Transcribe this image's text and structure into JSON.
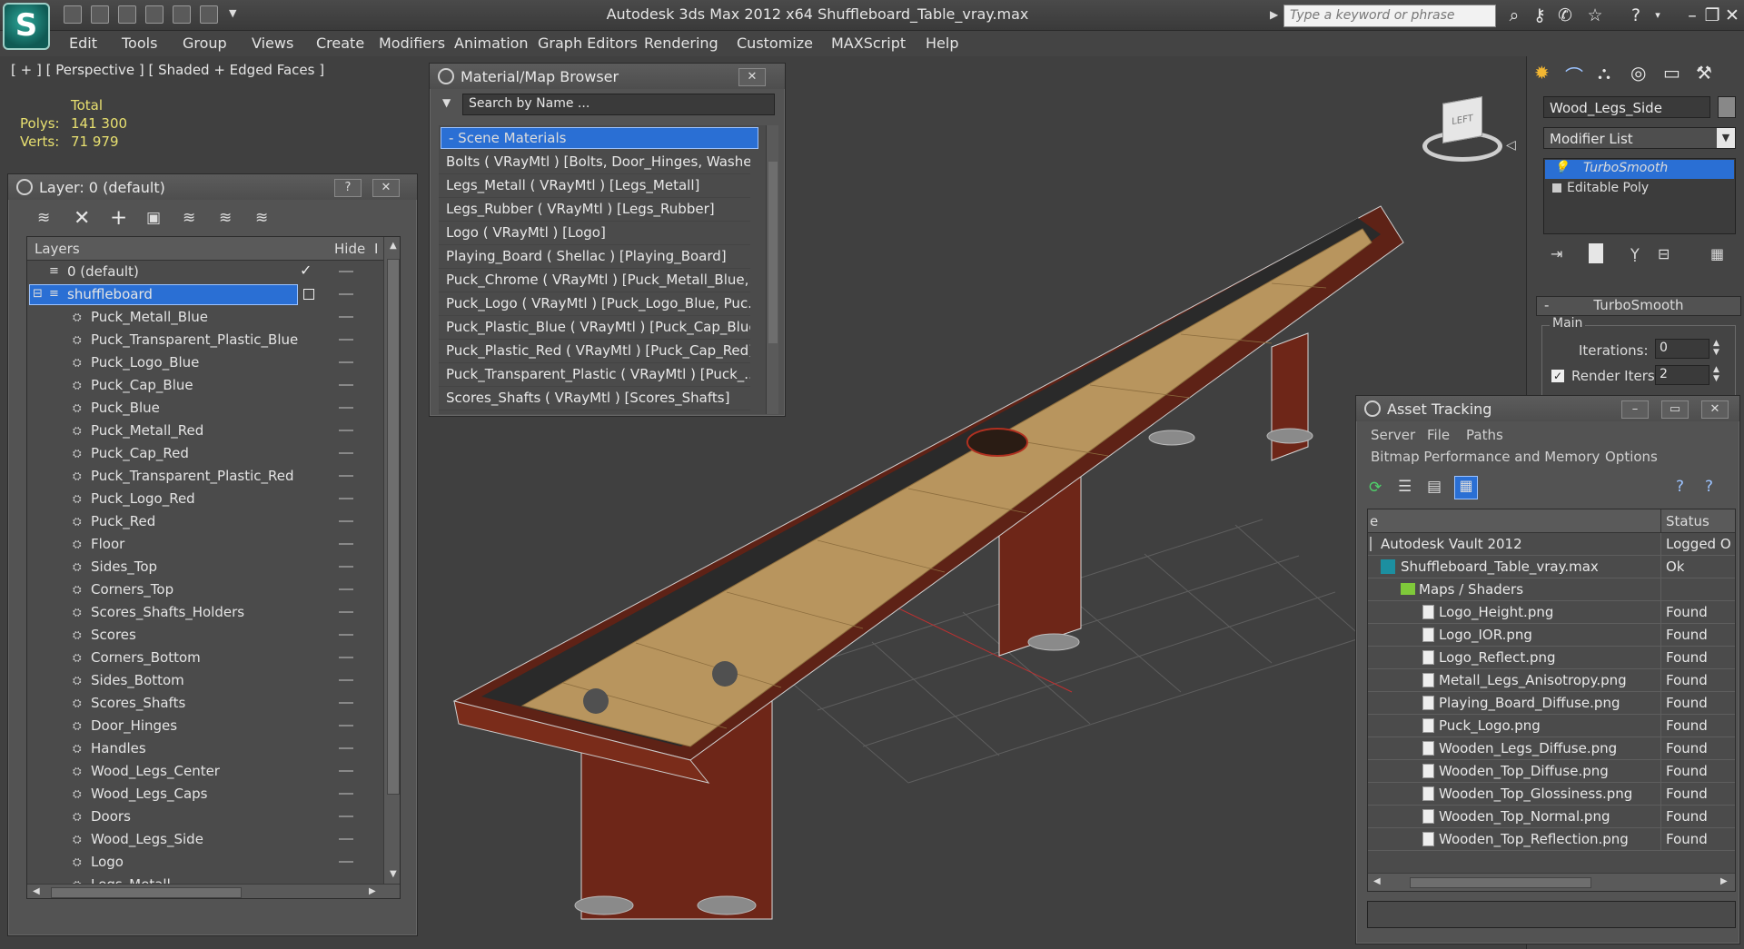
{
  "app": {
    "title": "Autodesk 3ds Max  2012 x64     Shuffleboard_Table_vray.max",
    "logo_letter": "S",
    "search_placeholder": "Type a keyword or phrase"
  },
  "menu": [
    "Edit",
    "Tools",
    "Group",
    "Views",
    "Create",
    "Modifiers",
    "Animation",
    "Graph Editors",
    "Rendering",
    "Customize",
    "MAXScript",
    "Help"
  ],
  "viewport": {
    "label": "[ + ] [ Perspective ] [ Shaded + Edged Faces ]",
    "stats_header": "Total",
    "stats": [
      {
        "key": "Polys:",
        "value": "141 300"
      },
      {
        "key": "Verts:",
        "value": "71 979"
      }
    ],
    "viewcube_label": "LEFT"
  },
  "layer_panel": {
    "title": "Layer: 0 (default)",
    "help_btn": "?",
    "col_layers": "Layers",
    "col_hide": "Hide",
    "col_extra": "I",
    "default_layer": "0 (default)",
    "active_layer": "shuffleboard",
    "items": [
      "Puck_Metall_Blue",
      "Puck_Transparent_Plastic_Blue",
      "Puck_Logo_Blue",
      "Puck_Cap_Blue",
      "Puck_Blue",
      "Puck_Metall_Red",
      "Puck_Cap_Red",
      "Puck_Transparent_Plastic_Red",
      "Puck_Logo_Red",
      "Puck_Red",
      "Floor",
      "Sides_Top",
      "Corners_Top",
      "Scores_Shafts_Holders",
      "Scores",
      "Corners_Bottom",
      "Sides_Bottom",
      "Scores_Shafts",
      "Door_Hinges",
      "Handles",
      "Wood_Legs_Center",
      "Wood_Legs_Caps",
      "Doors",
      "Wood_Legs_Side",
      "Logo",
      "Legs_Metall"
    ]
  },
  "material_browser": {
    "title": "Material/Map Browser",
    "search_placeholder": "Search by Name ...",
    "group": "- Scene Materials",
    "items": [
      "Bolts  ( VRayMtl ) [Bolts, Door_Hinges, Washe...",
      "Legs_Metall  ( VRayMtl ) [Legs_Metall]",
      "Legs_Rubber  ( VRayMtl ) [Legs_Rubber]",
      "Logo  ( VRayMtl ) [Logo]",
      "Playing_Board  ( Shellac ) [Playing_Board]",
      "Puck_Chrome  ( VRayMtl ) [Puck_Metall_Blue,...",
      "Puck_Logo  ( VRayMtl ) [Puck_Logo_Blue, Puc...",
      "Puck_Plastic_Blue  ( VRayMtl ) [Puck_Cap_Blue]",
      "Puck_Plastic_Red  ( VRayMtl ) [Puck_Cap_Red]",
      "Puck_Transparent_Plastic  ( VRayMtl ) [Puck_...",
      "Scores_Shafts  ( VRayMtl ) [Scores_Shafts]"
    ]
  },
  "command_panel": {
    "object_name": "Wood_Legs_Side",
    "modifier_list": "Modifier List",
    "stack": [
      "TurboSmooth",
      "Editable Poly"
    ],
    "rollout_title": "TurboSmooth",
    "group_main": "Main",
    "iterations_label": "Iterations:",
    "iterations_value": "0",
    "render_iters_label": "Render Iters:",
    "render_iters_value": "2"
  },
  "asset_tracking": {
    "title": "Asset Tracking",
    "menu1": [
      "Server",
      "File",
      "Paths"
    ],
    "menu2": [
      "Bitmap Performance and Memory",
      "Options"
    ],
    "col_name": "e",
    "col_status": "Status",
    "rows": [
      {
        "name": "Autodesk Vault 2012",
        "status": "Logged O"
      },
      {
        "name": "Shuffleboard_Table_vray.max",
        "status": "Ok"
      },
      {
        "name": "Maps / Shaders",
        "status": ""
      },
      {
        "name": "Logo_Height.png",
        "status": "Found"
      },
      {
        "name": "Logo_IOR.png",
        "status": "Found"
      },
      {
        "name": "Logo_Reflect.png",
        "status": "Found"
      },
      {
        "name": "Metall_Legs_Anisotropy.png",
        "status": "Found"
      },
      {
        "name": "Playing_Board_Diffuse.png",
        "status": "Found"
      },
      {
        "name": "Puck_Logo.png",
        "status": "Found"
      },
      {
        "name": "Wooden_Legs_Diffuse.png",
        "status": "Found"
      },
      {
        "name": "Wooden_Top_Diffuse.png",
        "status": "Found"
      },
      {
        "name": "Wooden_Top_Glossiness.png",
        "status": "Found"
      },
      {
        "name": "Wooden_Top_Normal.png",
        "status": "Found"
      },
      {
        "name": "Wooden_Top_Reflection.png",
        "status": "Found"
      }
    ]
  },
  "colors": {
    "selection": "#2a6fd4",
    "stats_yellow": "#e8e070",
    "wood": "#7a2c1a",
    "board": "#b8955e"
  }
}
